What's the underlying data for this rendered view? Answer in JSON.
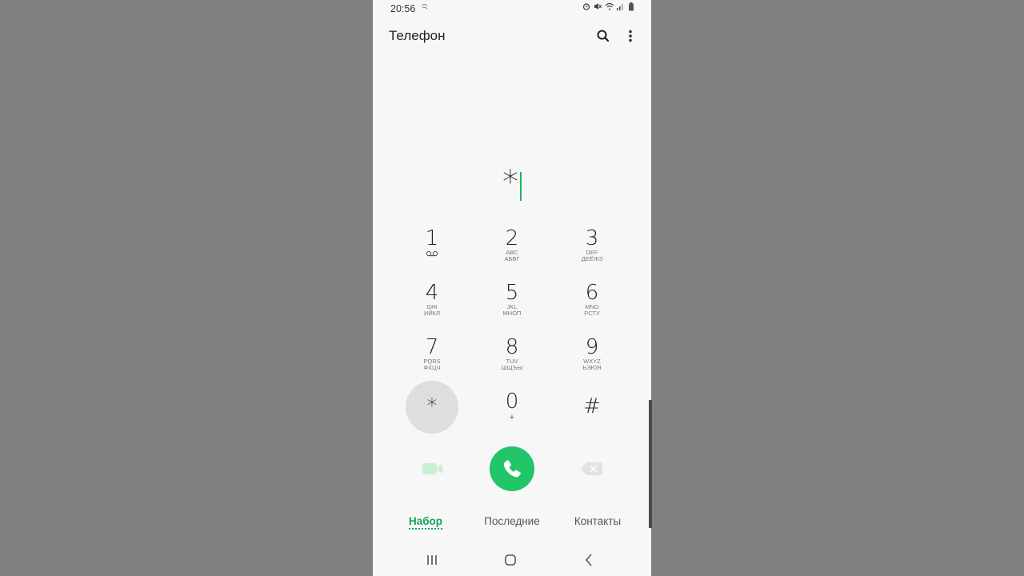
{
  "status_bar": {
    "time": "20:56",
    "extra_icon": "wind-icon",
    "icons": [
      "alarm-icon",
      "mute-icon",
      "wifi-icon",
      "signal-icon",
      "battery-icon"
    ]
  },
  "header": {
    "title": "Телефон",
    "search_icon": "search-icon",
    "more_icon": "more-vertical-icon"
  },
  "dialer": {
    "input_value": "*"
  },
  "keypad": [
    {
      "digit": "1",
      "letters": "",
      "letters2": "",
      "sub_icon": "voicemail-icon"
    },
    {
      "digit": "2",
      "letters": "ABC",
      "letters2": "АБВГ"
    },
    {
      "digit": "3",
      "letters": "DEF",
      "letters2": "ДЕЁЖЗ"
    },
    {
      "digit": "4",
      "letters": "GHI",
      "letters2": "ИЙКЛ"
    },
    {
      "digit": "5",
      "letters": "JKL",
      "letters2": "МНОП"
    },
    {
      "digit": "6",
      "letters": "MNO",
      "letters2": "РСТУ"
    },
    {
      "digit": "7",
      "letters": "PQRS",
      "letters2": "ФХЦЧ"
    },
    {
      "digit": "8",
      "letters": "TUV",
      "letters2": "ШЩЪЫ"
    },
    {
      "digit": "9",
      "letters": "WXYZ",
      "letters2": "ЬЭЮЯ"
    },
    {
      "digit": "*",
      "letters": "",
      "letters2": ""
    },
    {
      "digit": "0",
      "letters": "+",
      "letters2": ""
    },
    {
      "digit": "#",
      "letters": "",
      "letters2": ""
    }
  ],
  "actions": {
    "video_icon": "video-call-icon",
    "call_icon": "phone-icon",
    "backspace_icon": "backspace-icon",
    "call_color": "#22c567"
  },
  "tabs": [
    {
      "label": "Набор",
      "active": true
    },
    {
      "label": "Последние",
      "active": false
    },
    {
      "label": "Контакты",
      "active": false
    }
  ],
  "nav": {
    "recents_icon": "recent-apps-icon",
    "home_icon": "home-icon",
    "back_icon": "back-icon"
  },
  "colors": {
    "accent": "#1aa05a",
    "background": "#f7f7f7",
    "side": "#808080"
  }
}
